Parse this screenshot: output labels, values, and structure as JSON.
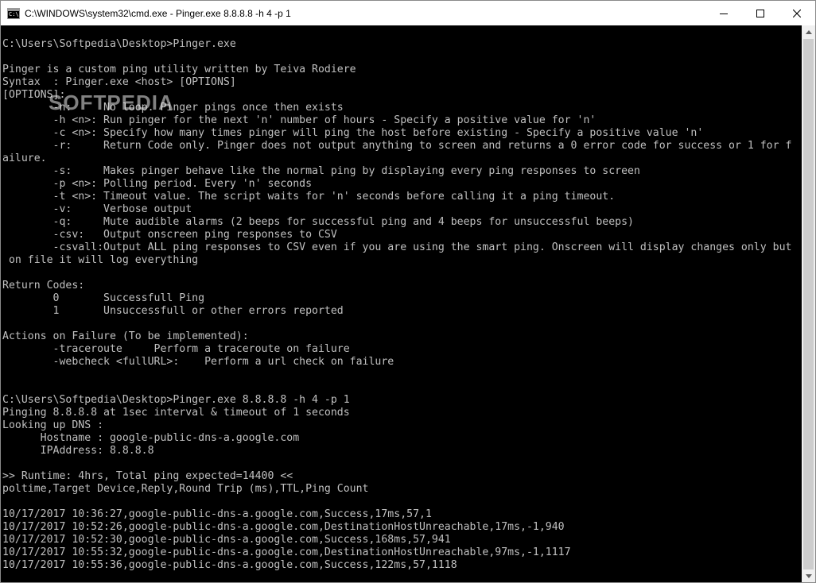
{
  "window": {
    "title": "C:\\WINDOWS\\system32\\cmd.exe - Pinger.exe  8.8.8.8 -h 4 -p 1",
    "app_icon": "cmd-icon",
    "controls": {
      "minimize": "minimize-icon",
      "maximize": "maximize-icon",
      "close": "close-icon"
    }
  },
  "watermark": "SOFTPEDIA",
  "console": {
    "lines": [
      "",
      "C:\\Users\\Softpedia\\Desktop>Pinger.exe",
      "",
      "Pinger is a custom ping utility written by Teiva Rodiere",
      "Syntax  : Pinger.exe <host> [OPTIONS]",
      "[OPTIONS]:",
      "        -n:     No loop. Pinger pings once then exists",
      "        -h <n>: Run pinger for the next 'n' number of hours - Specify a positive value for 'n'",
      "        -c <n>: Specify how many times pinger will ping the host before existing - Specify a positive value 'n'",
      "        -r:     Return Code only. Pinger does not output anything to screen and returns a 0 error code for success or 1 for f",
      "ailure.",
      "        -s:     Makes pinger behave like the normal ping by displaying every ping responses to screen",
      "        -p <n>: Polling period. Every 'n' seconds",
      "        -t <n>: Timeout value. The script waits for 'n' seconds before calling it a ping timeout.",
      "        -v:     Verbose output",
      "        -q:     Mute audible alarms (2 beeps for successful ping and 4 beeps for unsuccessful beeps)",
      "        -csv:   Output onscreen ping responses to CSV",
      "        -csvall:Output ALL ping responses to CSV even if you are using the smart ping. Onscreen will display changes only but",
      " on file it will log everything",
      "",
      "Return Codes:",
      "        0       Successfull Ping",
      "        1       Unsuccessfull or other errors reported",
      "",
      "Actions on Failure (To be implemented):",
      "        -traceroute     Perform a traceroute on failure",
      "        -webcheck <fullURL>:    Perform a url check on failure",
      "",
      "",
      "C:\\Users\\Softpedia\\Desktop>Pinger.exe 8.8.8.8 -h 4 -p 1",
      "Pinging 8.8.8.8 at 1sec interval & timeout of 1 seconds",
      "Looking up DNS :",
      "      Hostname : google-public-dns-a.google.com",
      "      IPAddress: 8.8.8.8",
      "",
      ">> Runtime: 4hrs, Total ping expected=14400 <<",
      "poltime,Target Device,Reply,Round Trip (ms),TTL,Ping Count",
      "",
      "10/17/2017 10:36:27,google-public-dns-a.google.com,Success,17ms,57,1",
      "10/17/2017 10:52:26,google-public-dns-a.google.com,DestinationHostUnreachable,17ms,-1,940",
      "10/17/2017 10:52:30,google-public-dns-a.google.com,Success,168ms,57,941",
      "10/17/2017 10:55:32,google-public-dns-a.google.com,DestinationHostUnreachable,97ms,-1,1117",
      "10/17/2017 10:55:36,google-public-dns-a.google.com,Success,122ms,57,1118"
    ]
  },
  "colors": {
    "console_background": "#000000",
    "console_text": "#c0c0c0",
    "titlebar_background": "#ffffff",
    "scrollbar_track": "#f0f0f0",
    "scrollbar_thumb": "#cdcdcd"
  }
}
